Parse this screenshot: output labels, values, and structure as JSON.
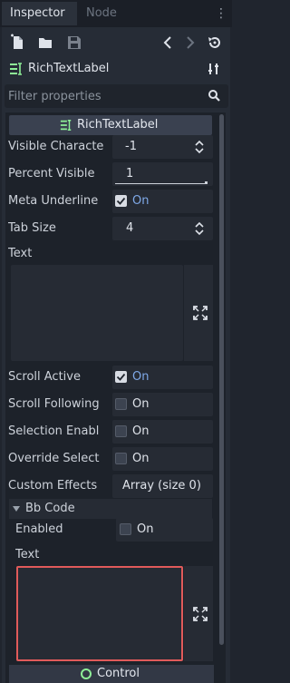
{
  "tabs": [
    {
      "label": "Inspector",
      "active": true
    },
    {
      "label": "Node",
      "active": false
    }
  ],
  "object": {
    "name": "RichTextLabel"
  },
  "filter": {
    "placeholder": "Filter properties"
  },
  "section": {
    "title": "RichTextLabel"
  },
  "properties": {
    "visible_characters": {
      "label": "Visible Characte",
      "value": "-1"
    },
    "percent_visible": {
      "label": "Percent Visible",
      "value": "1"
    },
    "meta_underline": {
      "label": "Meta Underline",
      "checked": true,
      "state": "On"
    },
    "tab_size": {
      "label": "Tab Size",
      "value": "4"
    },
    "text": {
      "label": "Text",
      "value": ""
    },
    "scroll_active": {
      "label": "Scroll Active",
      "checked": true,
      "state": "On"
    },
    "scroll_following": {
      "label": "Scroll Following",
      "checked": false,
      "state": "On"
    },
    "selection_enabled": {
      "label": "Selection Enabl",
      "checked": false,
      "state": "On"
    },
    "override_selected": {
      "label": "Override Select",
      "checked": false,
      "state": "On"
    },
    "custom_effects": {
      "label": "Custom Effects",
      "value": "Array (size 0)"
    }
  },
  "bbcode": {
    "title": "Bb Code",
    "enabled": {
      "label": "Enabled",
      "checked": false,
      "state": "On"
    },
    "text": {
      "label": "Text",
      "value": ""
    }
  },
  "footer": {
    "label": "Control"
  },
  "colors": {
    "accent": "#7fa9e8",
    "highlight_border": "#e05a5a",
    "footer_icon": "#8eef97"
  }
}
